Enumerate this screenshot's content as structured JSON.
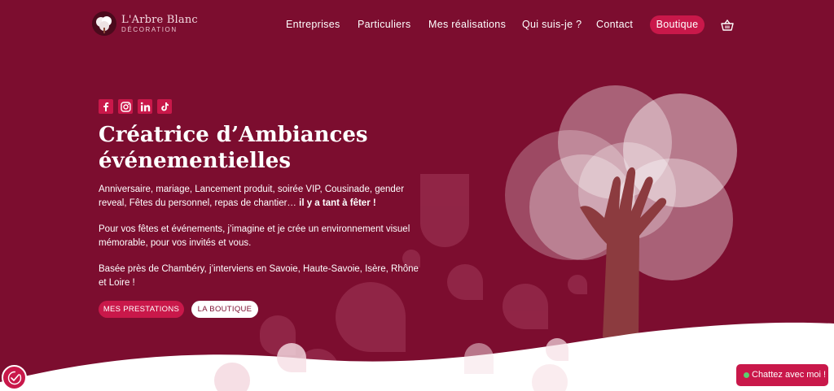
{
  "brand": {
    "name": "L'Arbre Blanc",
    "subtitle": "DÉCORATION",
    "accent": "#c9184a",
    "background": "#7c0d2f"
  },
  "nav": {
    "items": [
      "Entreprises",
      "Particuliers",
      "Mes réalisations",
      "Qui suis-je ?",
      "Contact"
    ],
    "shop_label": "Boutique",
    "cart_icon": "basket-icon"
  },
  "social": {
    "icons": [
      "facebook-icon",
      "instagram-icon",
      "linkedin-icon",
      "tiktok-icon"
    ]
  },
  "hero": {
    "title_line1": "Créatrice d’Ambiances",
    "title_line2": "événementielles",
    "p1_text": "Anniversaire, mariage, Lancement produit, soirée VIP, Cousinade, gender reveal, Fêtes du personnel, repas de chantier…",
    "p1_strong": "il y a tant à fêter !",
    "p2": "Pour vos fêtes et événements, j’imagine et je crée un environnement visuel mémorable, pour vos invités et vous.",
    "p3": "Basée près de Chambéry, j’interviens en Savoie, Haute-Savoie, Isère, Rhône et Loire !",
    "btn_primary": "MES PRESTATIONS",
    "btn_secondary": "LA BOUTIQUE"
  },
  "chat": {
    "label": "Chattez avec moi !",
    "status_color": "#5ad06f"
  },
  "cookie": {
    "icon": "cookie-consent-icon"
  }
}
